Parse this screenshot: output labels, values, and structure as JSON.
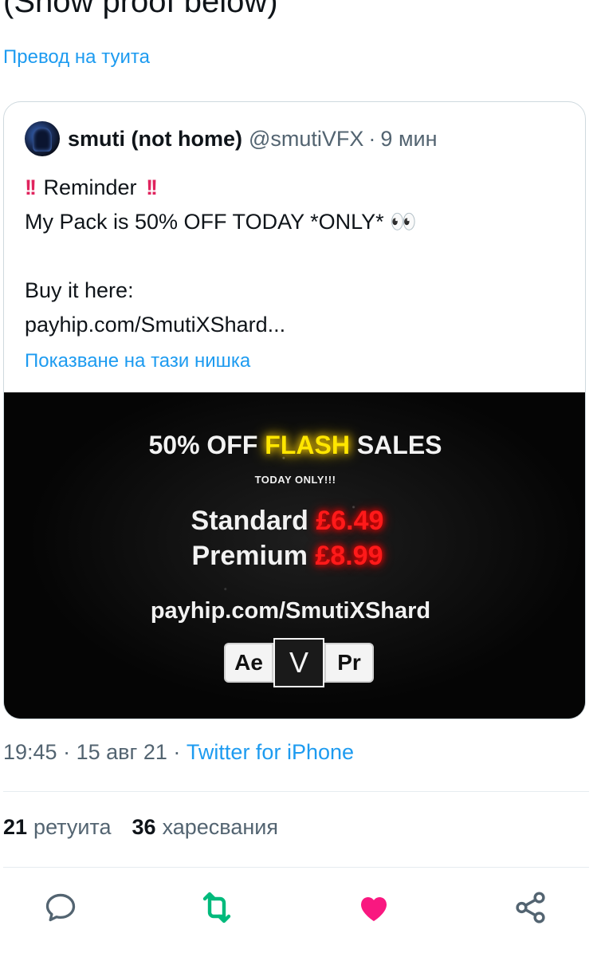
{
  "top_cut_text": "(Show proof below)",
  "translate_link": "Превод на туита",
  "quote": {
    "display_name": "smuti (not home)",
    "handle": "@smutiVFX",
    "separator": "·",
    "time": "9 мин",
    "bang": "!!",
    "reminder": "Reminder",
    "line2": "My Pack is 50% OFF TODAY *ONLY* 👀",
    "line3": "Buy it here:",
    "line4": "payhip.com/SmutiXShard...",
    "show_thread": "Показване на тази нишка"
  },
  "promo": {
    "title_prefix": "50% OFF ",
    "title_flash": "FLASH",
    "title_suffix": " SALES",
    "today_only": "TODAY ONLY!!!",
    "standard_label": "Standard ",
    "standard_price": "£6.49",
    "premium_label": "Premium ",
    "premium_price": "£8.99",
    "url": "payhip.com/SmutiXShard",
    "badge_ae": "Ae",
    "badge_v": "V",
    "badge_pr": "Pr"
  },
  "meta": {
    "time": "19:45",
    "sep": "·",
    "date": "15 авг 21",
    "source": "Twitter for iPhone"
  },
  "stats": {
    "retweets_count": "21",
    "retweets_label": "ретуита",
    "likes_count": "36",
    "likes_label": "харесвания"
  },
  "colors": {
    "link": "#1d9bf0",
    "retweet_green": "#00ba7c",
    "like_red": "#f91880",
    "muted": "#536471"
  },
  "icons": [
    "reply-icon",
    "retweet-icon",
    "like-icon",
    "share-icon"
  ]
}
